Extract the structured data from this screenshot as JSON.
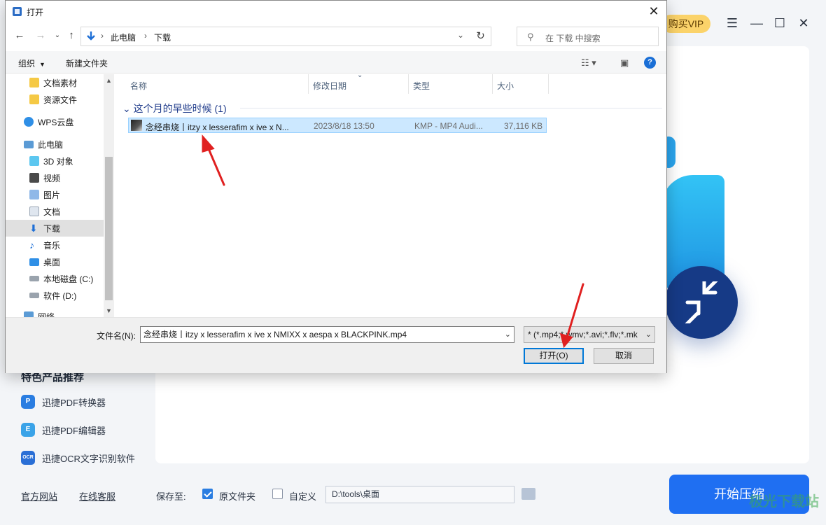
{
  "app": {
    "vip_label": "购买VIP",
    "products_title": "特色产品推荐",
    "products": [
      {
        "label": "迅捷PDF转换器",
        "icon": "pdf-converter-icon"
      },
      {
        "label": "迅捷PDF编辑器",
        "icon": "pdf-editor-icon"
      },
      {
        "label": "迅捷OCR文字识别软件",
        "icon": "ocr-icon"
      }
    ],
    "links": {
      "website": "官方网站",
      "support": "在线客服"
    },
    "save_to_label": "保存至:",
    "option_original": "原文件夹",
    "option_custom": "自定义",
    "save_path": "D:\\tools\\桌面",
    "start_button": "开始压缩",
    "watermark": "极光下载站"
  },
  "dialog": {
    "title": "打开",
    "address": {
      "segments": [
        "此电脑",
        "下载"
      ]
    },
    "search_placeholder": "在 下载 中搜索",
    "toolbar": {
      "organize": "组织",
      "new_folder": "新建文件夹"
    },
    "sidebar": [
      {
        "label": "文档素材",
        "icon": "folder-icon"
      },
      {
        "label": "资源文件",
        "icon": "folder-icon"
      },
      {
        "label": "WPS云盘",
        "icon": "cloud-icon"
      },
      {
        "label": "此电脑",
        "icon": "computer-icon"
      },
      {
        "label": "3D 对象",
        "icon": "3d-objects-icon"
      },
      {
        "label": "视频",
        "icon": "video-icon"
      },
      {
        "label": "图片",
        "icon": "pictures-icon"
      },
      {
        "label": "文档",
        "icon": "documents-icon"
      },
      {
        "label": "下载",
        "icon": "download-icon",
        "selected": true
      },
      {
        "label": "音乐",
        "icon": "music-icon"
      },
      {
        "label": "桌面",
        "icon": "desktop-icon"
      },
      {
        "label": "本地磁盘 (C:)",
        "icon": "drive-icon"
      },
      {
        "label": "软件 (D:)",
        "icon": "drive-icon"
      },
      {
        "label": "网络",
        "icon": "network-icon"
      }
    ],
    "columns": [
      "名称",
      "修改日期",
      "类型",
      "大小"
    ],
    "group_header": "这个月的早些时候 (1)",
    "files": [
      {
        "name": "念经串烧丨itzy x lesserafim x ive x N...",
        "date": "2023/8/18 13:50",
        "type": "KMP - MP4 Audi...",
        "size": "37,116 KB"
      }
    ],
    "filename_label": "文件名(N):",
    "filename_value": "念经串烧丨itzy x lesserafim x ive x NMIXX x aespa x BLACKPINK.mp4",
    "filter_value": "* (*.mp4;*.wmv;*.avi;*.flv;*.mk",
    "open_button": "打开(O)",
    "cancel_button": "取消"
  }
}
